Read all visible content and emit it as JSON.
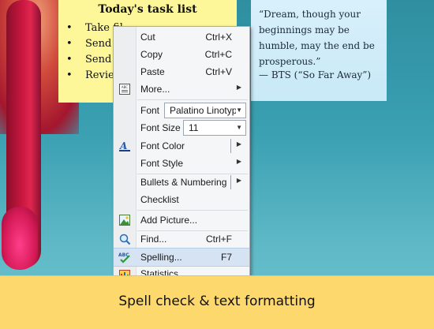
{
  "task_note": {
    "title": "Today's task list",
    "items": [
      "Take fil",
      "Send",
      "Send",
      "Revie"
    ]
  },
  "quote_note": {
    "quote": "“Dream, though your beginnings may be humble, may the end be prosperous.”",
    "attribution": "— BTS (“So Far Away”)"
  },
  "context_menu": {
    "cut": {
      "label": "Cut",
      "shortcut": "Ctrl+X"
    },
    "copy": {
      "label": "Copy",
      "shortcut": "Ctrl+C"
    },
    "paste": {
      "label": "Paste",
      "shortcut": "Ctrl+V"
    },
    "more": {
      "label": "More..."
    },
    "font": {
      "label": "Font",
      "value": "Palatino Linotype"
    },
    "font_size": {
      "label": "Font Size",
      "value": "11"
    },
    "font_color": {
      "label": "Font Color"
    },
    "font_style": {
      "label": "Font Style"
    },
    "bullets": {
      "label": "Bullets & Numbering"
    },
    "checklist": {
      "label": "Checklist"
    },
    "add_picture": {
      "label": "Add Picture..."
    },
    "find": {
      "label": "Find...",
      "shortcut": "Ctrl+F"
    },
    "spelling": {
      "label": "Spelling...",
      "shortcut": "F7"
    },
    "statistics": {
      "label": "Statistics"
    }
  },
  "banner": {
    "text": "Spell check & text formatting"
  },
  "colors": {
    "banner": "#fdd96d",
    "note_yellow": "#fdf79a",
    "note_blue": "#cdebf8",
    "menu_highlight": "#d6e3f2"
  }
}
